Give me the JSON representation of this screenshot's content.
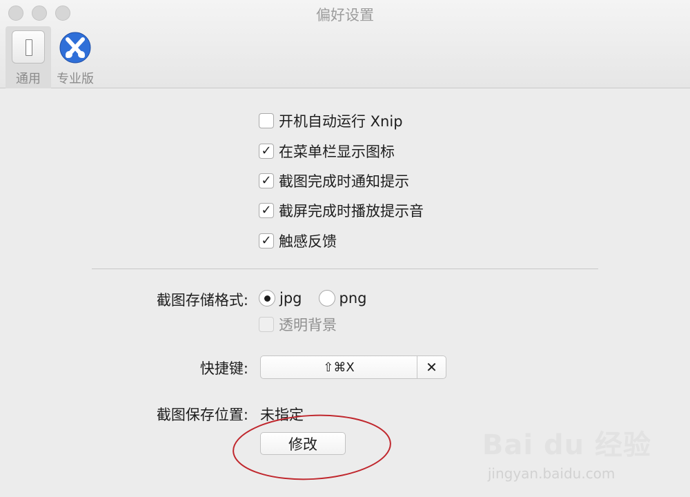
{
  "window": {
    "title": "偏好设置"
  },
  "toolbar": {
    "general_label": "通用",
    "pro_label": "专业版"
  },
  "options": [
    {
      "label": "开机自动运行 Xnip",
      "checked": false
    },
    {
      "label": "在菜单栏显示图标",
      "checked": true
    },
    {
      "label": "截图完成时通知提示",
      "checked": true
    },
    {
      "label": "截屏完成时播放提示音",
      "checked": true
    },
    {
      "label": "触感反馈",
      "checked": true
    }
  ],
  "format": {
    "label": "截图存储格式:",
    "options": [
      {
        "label": "jpg",
        "selected": true
      },
      {
        "label": "png",
        "selected": false
      }
    ],
    "transparent_label": "透明背景"
  },
  "shortcut": {
    "label": "快捷键:",
    "keys": "⇧⌘X",
    "clear_symbol": "✕"
  },
  "save_location": {
    "label": "截图保存位置:",
    "value": "未指定",
    "button_label": "修改"
  },
  "watermark": {
    "logo_text": "Bai du 经验",
    "url": "jingyan.baidu.com"
  },
  "colors": {
    "annotation": "#c0272d",
    "pro_icon": "#2f6fd8"
  }
}
